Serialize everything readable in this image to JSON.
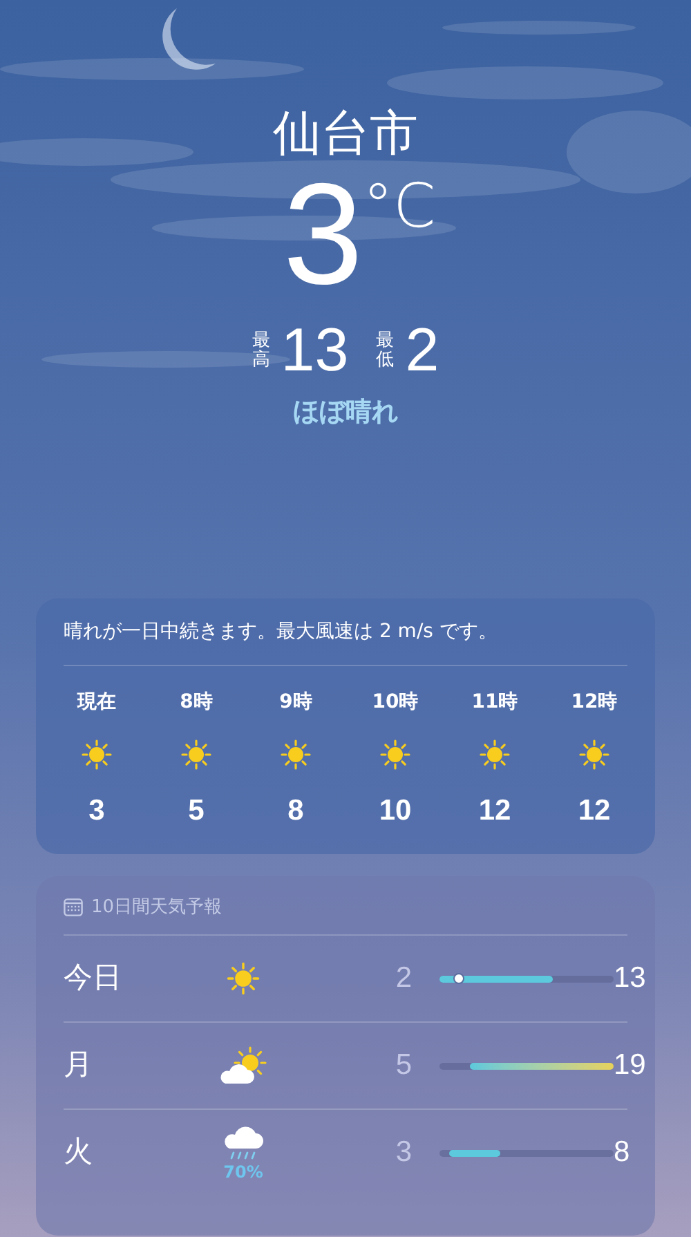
{
  "location": {
    "city": "仙台市",
    "temperature": "3",
    "unit": "°C",
    "high_label": "最高",
    "high": "13",
    "low_label": "最低",
    "low": "2",
    "condition": "ほぼ晴れ"
  },
  "hourly": {
    "summary": "晴れが一日中続きます。最大風速は 2 m/s です。",
    "hours": [
      {
        "time": "現在",
        "kind": "sun",
        "temp": "3"
      },
      {
        "time": "8時",
        "kind": "sun",
        "temp": "5"
      },
      {
        "time": "9時",
        "kind": "sun",
        "temp": "8"
      },
      {
        "time": "10時",
        "kind": "sun",
        "temp": "10"
      },
      {
        "time": "11時",
        "kind": "sun",
        "temp": "12"
      },
      {
        "time": "12時",
        "kind": "sun",
        "temp": "12"
      }
    ]
  },
  "daily": {
    "title": "10日間天気予報",
    "days": [
      {
        "day": "今日",
        "kind": "sun",
        "low": "2",
        "high": "13",
        "current_marker": true
      },
      {
        "day": "月",
        "kind": "partly-cloudy",
        "low": "5",
        "high": "19",
        "current_marker": false
      },
      {
        "day": "火",
        "kind": "rain",
        "precipitation": "70%",
        "low": "3",
        "high": "8",
        "current_marker": false
      }
    ]
  }
}
